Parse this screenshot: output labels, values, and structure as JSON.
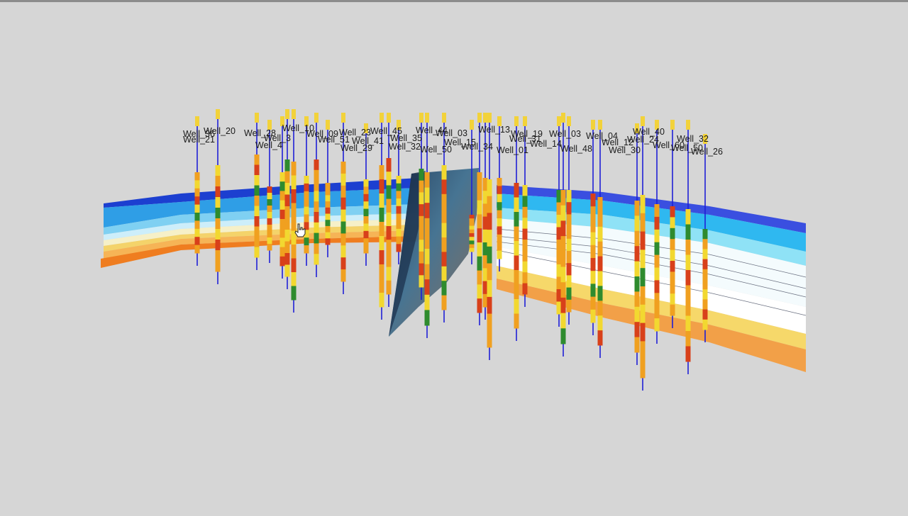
{
  "scene": {
    "background": "#d6d6d6",
    "colors": {
      "well_stick": "#1f1fd6",
      "log_orange": "#f0a020",
      "log_yellow": "#f2d830",
      "log_red": "#d8401a",
      "log_green": "#2e8b2e",
      "well_head": "#f2d23a",
      "fault_plane": "#2a4a6a"
    },
    "icons": [
      "hand-cursor-icon"
    ]
  },
  "wells": [
    {
      "label": "Well_36"
    },
    {
      "label": "Well_20"
    },
    {
      "label": "Well_21"
    },
    {
      "label": "Well_28"
    },
    {
      "label": "Well_10"
    },
    {
      "label": "Well_3"
    },
    {
      "label": "Well_4"
    },
    {
      "label": "Well_09"
    },
    {
      "label": "Well_51"
    },
    {
      "label": "Well_23"
    },
    {
      "label": "Well_29"
    },
    {
      "label": "Well_45"
    },
    {
      "label": "Well_41"
    },
    {
      "label": "Well_35"
    },
    {
      "label": "Well_32"
    },
    {
      "label": "Well_44"
    },
    {
      "label": "Well_03"
    },
    {
      "label": "Well_15"
    },
    {
      "label": "Well_50"
    },
    {
      "label": "Well_34"
    },
    {
      "label": "Well_13"
    },
    {
      "label": "Well_19"
    },
    {
      "label": "Well_31"
    },
    {
      "label": "Well_01"
    },
    {
      "label": "Well_14"
    },
    {
      "label": "Well_03"
    },
    {
      "label": "Well_48"
    },
    {
      "label": "Well_04"
    },
    {
      "label": "Well_12"
    },
    {
      "label": "Well_30"
    },
    {
      "label": "Well_40"
    },
    {
      "label": "Well_24"
    },
    {
      "label": "Well_60"
    },
    {
      "label": "Well_32"
    },
    {
      "label": "Well_50"
    },
    {
      "label": "Well_26"
    }
  ]
}
